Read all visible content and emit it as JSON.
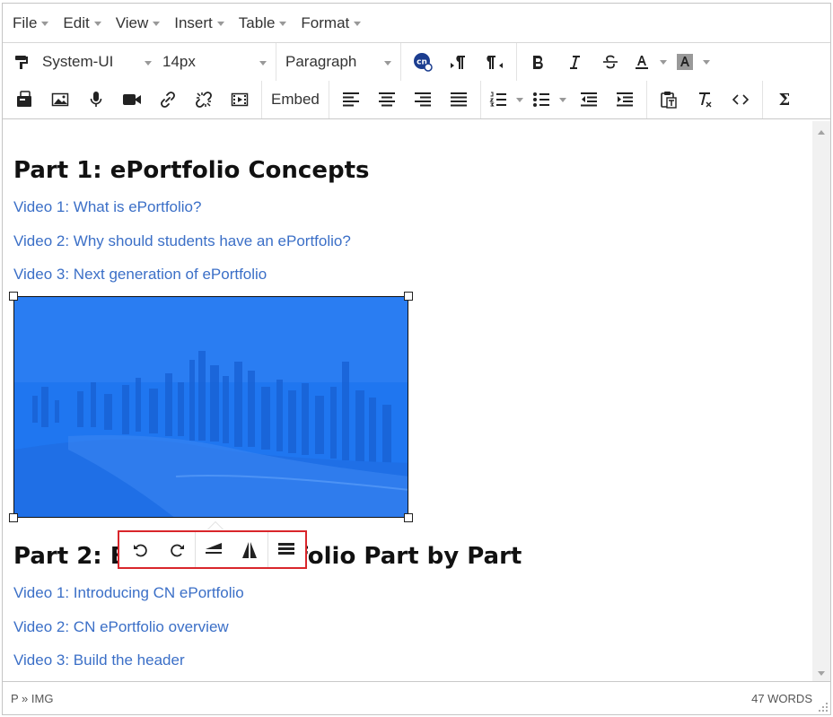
{
  "menubar": {
    "items": [
      {
        "label": "File"
      },
      {
        "label": "Edit"
      },
      {
        "label": "View"
      },
      {
        "label": "Insert"
      },
      {
        "label": "Table"
      },
      {
        "label": "Format"
      }
    ]
  },
  "toolbar": {
    "font_family": "System-UI",
    "font_size": "14px",
    "block_format": "Paragraph",
    "embed_label": "Embed",
    "cn_badge": "cn",
    "sigma": "Σ",
    "icons": [
      "format-painter-icon",
      "cn-link-icon",
      "ltr-icon",
      "rtl-icon",
      "bold-icon",
      "italic-icon",
      "strikethrough-icon",
      "text-color-icon",
      "background-color-icon",
      "paste-file-icon",
      "image-icon",
      "microphone-icon",
      "video-camera-icon",
      "link-icon",
      "unlink-icon",
      "media-icon",
      "align-left-icon",
      "align-center-icon",
      "align-right-icon",
      "align-justify-icon",
      "numbered-list-icon",
      "bulleted-list-icon",
      "outdent-icon",
      "indent-icon",
      "paste-text-icon",
      "clear-formatting-icon",
      "source-code-icon"
    ]
  },
  "content": {
    "part1_heading": "Part 1: ePortfolio Concepts",
    "part1_links": [
      "Video 1: What is ePortfolio?",
      "Video 2: Why should students have an ePortfolio?",
      "Video 3: Next generation of ePortfolio"
    ],
    "part2_heading": "Part 2: Build an ePortfolio Part by Part",
    "part2_links": [
      "Video 1: Introducing CN ePortfolio",
      "Video 2: CN ePortfolio overview",
      "Video 3: Build the header"
    ],
    "image": {
      "tint": "#1f76f0"
    }
  },
  "image_toolbar": {
    "icons": [
      "rotate-left-icon",
      "rotate-right-icon",
      "flip-vertical-icon",
      "flip-horizontal-icon",
      "image-options-icon"
    ],
    "highlight_color": "#d9262b"
  },
  "status": {
    "path": "P » IMG",
    "word_count": "47 WORDS"
  },
  "colors": {
    "link": "#3b6fc7",
    "border": "#c5c5c5"
  }
}
